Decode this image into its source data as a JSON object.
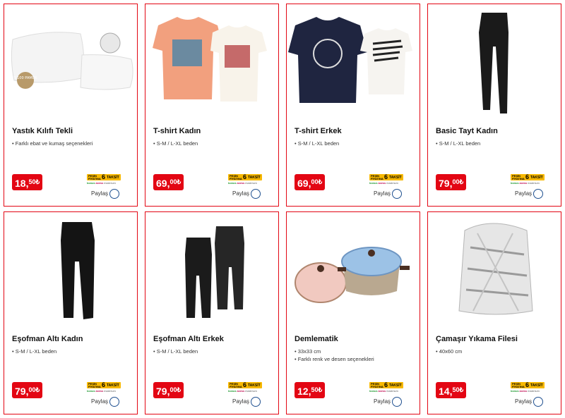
{
  "products": [
    {
      "title": "Yastık Kılıfı Tekli",
      "bullets": [
        "Farklı ebat ve kumaş seçenekleri"
      ],
      "price_int": "18,",
      "price_dec": "50",
      "currency": "₺",
      "share": "Paylaş",
      "image": "pillow-cases",
      "stamp": "%100 PAMUK"
    },
    {
      "title": "T-shirt Kadın",
      "bullets": [
        "S-M / L-XL beden"
      ],
      "price_int": "69,",
      "price_dec": "00",
      "currency": "₺",
      "share": "Paylaş",
      "image": "womens-tshirts"
    },
    {
      "title": "T-shirt Erkek",
      "bullets": [
        "S-M / L-XL beden"
      ],
      "price_int": "69,",
      "price_dec": "00",
      "currency": "₺",
      "share": "Paylaş",
      "image": "mens-tshirts"
    },
    {
      "title": "Basic Tayt Kadın",
      "bullets": [
        "S-M / L-XL beden"
      ],
      "price_int": "79,",
      "price_dec": "00",
      "currency": "₺",
      "share": "Paylaş",
      "image": "leggings"
    },
    {
      "title": "Eşofman Altı Kadın",
      "bullets": [
        "S-M / L-XL beden"
      ],
      "price_int": "79,",
      "price_dec": "00",
      "currency": "₺",
      "share": "Paylaş",
      "image": "womens-joggers"
    },
    {
      "title": "Eşofman Altı Erkek",
      "bullets": [
        "S-M / L-XL beden"
      ],
      "price_int": "79,",
      "price_dec": "00",
      "currency": "₺",
      "share": "Paylaş",
      "image": "mens-joggers"
    },
    {
      "title": "Demlematik",
      "bullets": [
        "33x33 cm",
        "Farklı renk ve desen seçenekleri"
      ],
      "price_int": "12,",
      "price_dec": "50",
      "currency": "₺",
      "share": "Paylaş",
      "image": "pot-covers"
    },
    {
      "title": "Çamaşır Yıkama Filesi",
      "bullets": [
        "40x60 cm"
      ],
      "price_int": "14,",
      "price_dec": "50",
      "currency": "₺",
      "share": "Paylaş",
      "image": "laundry-bag"
    }
  ],
  "installment_badge": {
    "pesin": "PEŞİN",
    "fiyatina": "FİYATINA",
    "number": "6",
    "label": "TAKSİT",
    "cards": [
      "bonus",
      "axess",
      "maximum",
      "world",
      "bankkart"
    ]
  },
  "colors": {
    "accent": "#e30613",
    "badge": "#f7b800",
    "share_circle": "#1e4f8f"
  }
}
